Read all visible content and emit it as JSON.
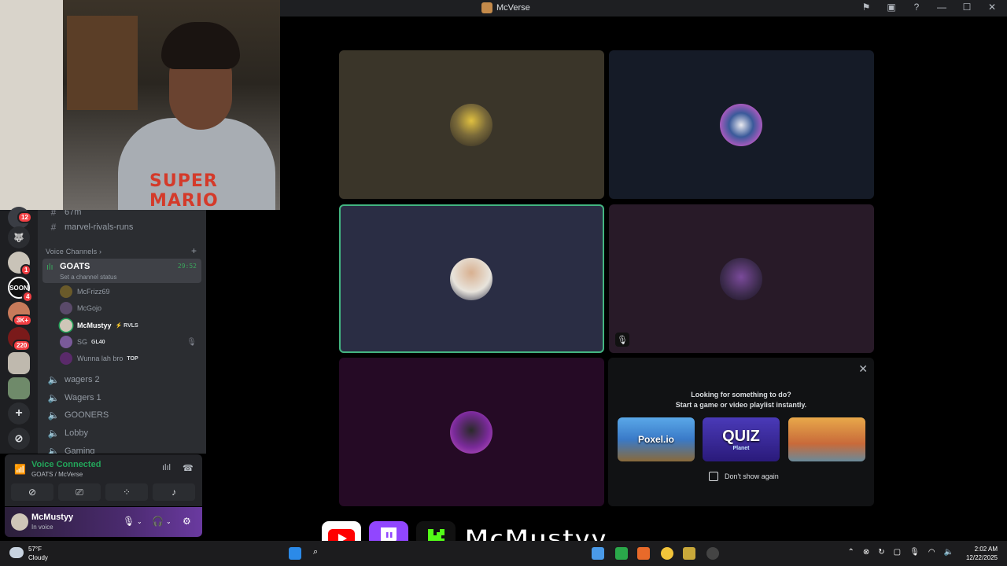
{
  "window": {
    "title": "McVerse",
    "controls": {
      "minimize": "—",
      "maximize": "☐",
      "close": "✕"
    }
  },
  "webcam": {
    "shirt_text": "SUPER MARIO"
  },
  "servers": [
    {
      "name": "server-1",
      "badge": "12",
      "color": "#3a3d44"
    },
    {
      "name": "server-2",
      "badge": "",
      "color": "#2b2d31"
    },
    {
      "name": "server-3",
      "badge": "1",
      "color": "#c9c3b8"
    },
    {
      "name": "server-4",
      "badge": "4",
      "label": "SOON",
      "color": "#111"
    },
    {
      "name": "server-5",
      "badge": "3K+",
      "color": "#c77a5a"
    },
    {
      "name": "server-6",
      "badge": "220",
      "color": "#7a1a1a"
    },
    {
      "name": "server-7",
      "badge": "",
      "color": "#bfb9ae"
    },
    {
      "name": "server-8",
      "badge": "",
      "color": "#6f8a6a"
    }
  ],
  "channels": {
    "top_partial": "67m",
    "text_channel": "marvel-rivals-runs",
    "voice_section": "Voice Channels",
    "active_voice": {
      "name": "GOATS",
      "status": "Set a channel status",
      "timer": "29:52"
    },
    "members": [
      {
        "name": "McFrizz69",
        "tag": "",
        "color": "#6a5a2a"
      },
      {
        "name": "McGojo",
        "tag": "",
        "color": "#5a4a6a"
      },
      {
        "name": "McMustyy",
        "tag": "⚡ RVLS",
        "color": "#cfc6b8"
      },
      {
        "name": "SG",
        "tag": "GL40",
        "color": "#7a5a9a"
      },
      {
        "name": "Wunna lah bro",
        "tag": "TOP",
        "color": "#5a2a6a"
      }
    ],
    "voice_channels": [
      "wagers 2",
      "Wagers 1",
      "GOONERS",
      "Lobby",
      "Gaming"
    ]
  },
  "voice_panel": {
    "title": "Voice Connected",
    "subtitle": "GOATS / McVerse"
  },
  "user_panel": {
    "name": "McMustyy",
    "status": "In voice"
  },
  "tiles": [
    {
      "name": "tile-mcfrizz",
      "bg": "#3a3529",
      "avatar": "#7a6a3a"
    },
    {
      "name": "tile-mcgojo",
      "bg": "#151b27",
      "avatar": "#c85ac8"
    },
    {
      "name": "tile-mcmustyy",
      "bg": "#2a2d44",
      "avatar": "#e8e4dc"
    },
    {
      "name": "tile-sg",
      "bg": "#281a28",
      "avatar": "#5a3a7a"
    },
    {
      "name": "tile-wunna",
      "bg": "#250a25",
      "avatar": "#7a2a9a"
    }
  ],
  "activity": {
    "line1": "Looking for something to do?",
    "line2": "Start a game or video playlist instantly.",
    "games": [
      {
        "title": "Poxel.io",
        "color": "#3a7ac8"
      },
      {
        "title": "QUIZ",
        "sub": "Planet",
        "color": "#3a2a9a"
      },
      {
        "title": "",
        "color": "#d88a3a"
      }
    ],
    "dont_show": "Don't show again"
  },
  "overlay": {
    "name": "McMustyy"
  },
  "taskbar": {
    "weather_temp": "57°F",
    "weather_desc": "Cloudy",
    "time": "2:02 AM",
    "date": "12/22/2025"
  }
}
